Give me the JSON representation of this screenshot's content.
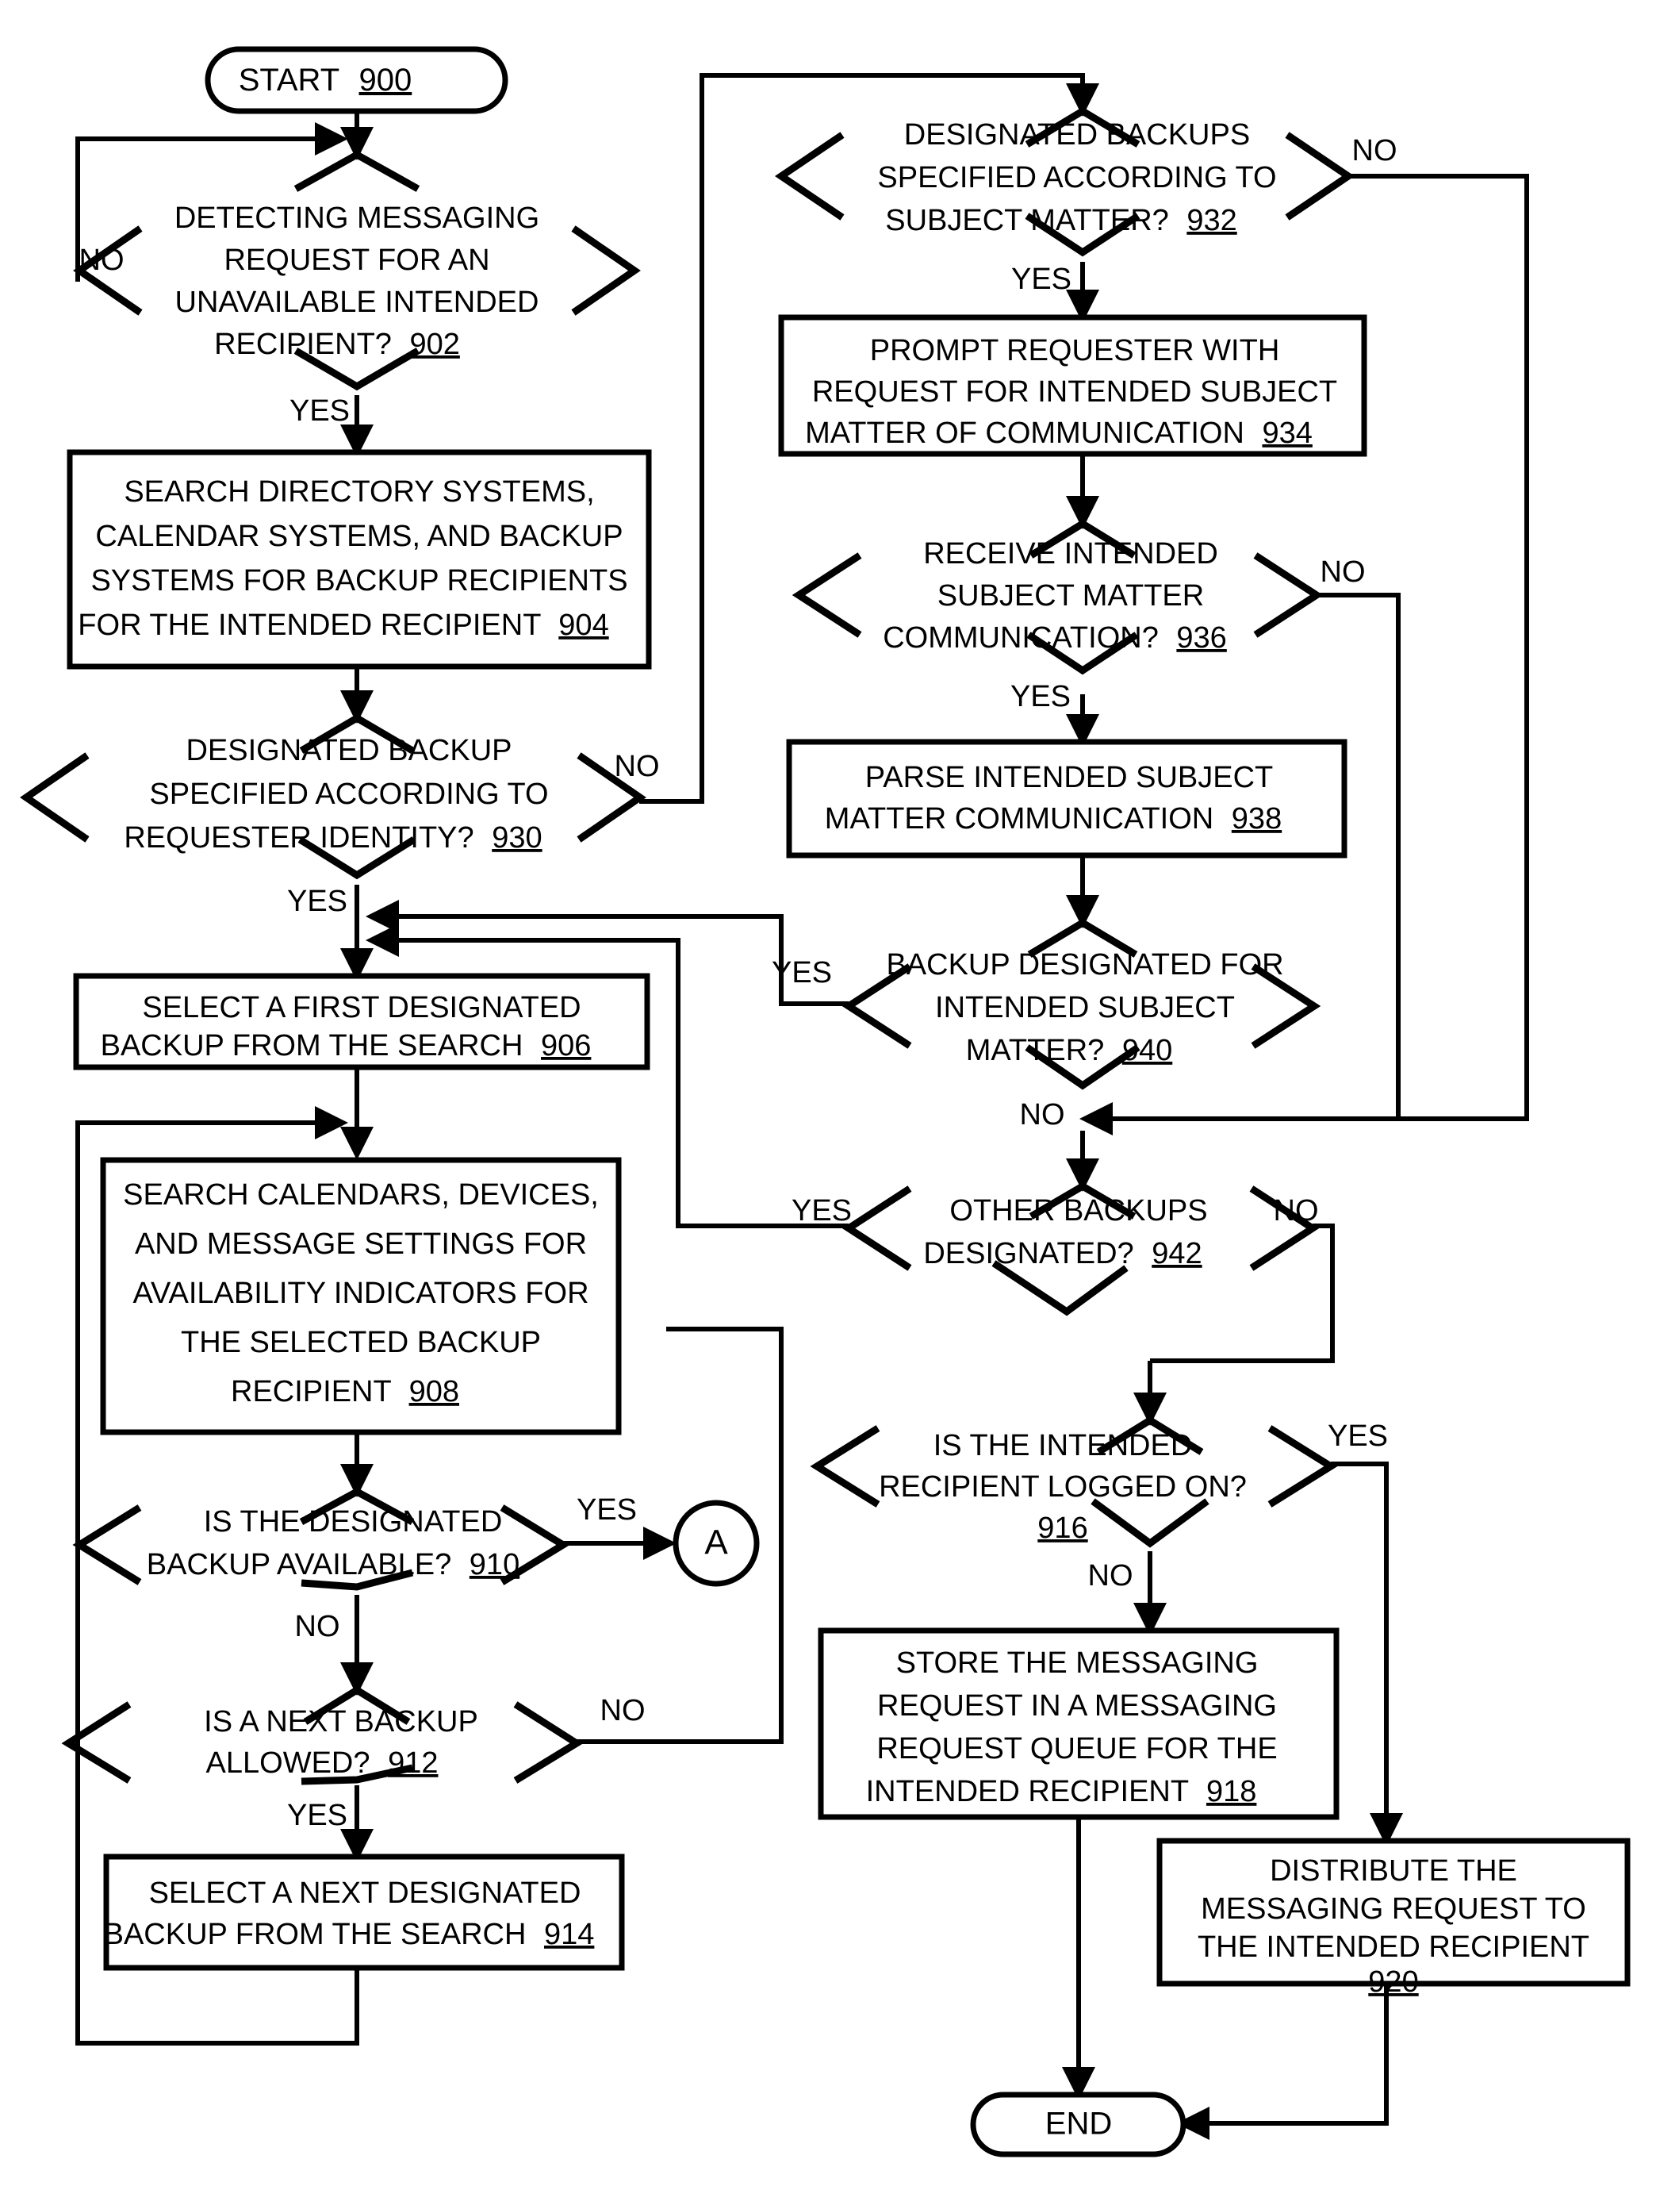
{
  "figure": {
    "type": "patent-flowchart",
    "orientation": "portrait",
    "background_color": "#ffffff",
    "line_color": "#000000"
  },
  "nodes": {
    "start": {
      "shape": "terminator",
      "label": "START",
      "ref": "900"
    },
    "n902": {
      "shape": "decision",
      "lines": [
        "DETECTING MESSAGING",
        "REQUEST FOR AN",
        "UNAVAILABLE INTENDED",
        "RECIPIENT?"
      ],
      "ref": "902"
    },
    "n904": {
      "shape": "process",
      "lines": [
        "SEARCH DIRECTORY SYSTEMS,",
        "CALENDAR SYSTEMS, AND BACKUP",
        "SYSTEMS FOR BACKUP RECIPIENTS",
        "FOR THE INTENDED RECIPIENT"
      ],
      "ref": "904"
    },
    "n930": {
      "shape": "decision",
      "lines": [
        "DESIGNATED BACKUP",
        "SPECIFIED ACCORDING TO",
        "REQUESTER IDENTITY?"
      ],
      "ref": "930"
    },
    "n906": {
      "shape": "process",
      "lines": [
        "SELECT A FIRST DESIGNATED",
        "BACKUP FROM THE SEARCH"
      ],
      "ref": "906"
    },
    "n908": {
      "shape": "process",
      "lines": [
        "SEARCH CALENDARS, DEVICES,",
        "AND MESSAGE SETTINGS FOR",
        "AVAILABILITY INDICATORS FOR",
        "THE SELECTED BACKUP",
        "RECIPIENT"
      ],
      "ref": "908"
    },
    "n910": {
      "shape": "decision",
      "lines": [
        "IS THE DESIGNATED",
        "BACKUP AVAILABLE?"
      ],
      "ref": "910"
    },
    "n912": {
      "shape": "decision",
      "lines": [
        "IS A NEXT BACKUP",
        "ALLOWED?"
      ],
      "ref": "912"
    },
    "n914": {
      "shape": "process",
      "lines": [
        "SELECT A NEXT DESIGNATED",
        "BACKUP FROM THE SEARCH"
      ],
      "ref": "914"
    },
    "connA": {
      "shape": "connector",
      "label": "A"
    },
    "n932": {
      "shape": "decision",
      "lines": [
        "DESIGNATED BACKUPS",
        "SPECIFIED ACCORDING TO",
        "SUBJECT MATTER?"
      ],
      "ref": "932"
    },
    "n934": {
      "shape": "process",
      "lines": [
        "PROMPT REQUESTER WITH",
        "REQUEST FOR INTENDED SUBJECT",
        "MATTER OF COMMUNICATION"
      ],
      "ref": "934"
    },
    "n936": {
      "shape": "decision",
      "lines": [
        "RECEIVE INTENDED",
        "SUBJECT MATTER",
        "COMMUNICATION?"
      ],
      "ref": "936"
    },
    "n938": {
      "shape": "process",
      "lines": [
        "PARSE INTENDED SUBJECT",
        "MATTER COMMUNICATION"
      ],
      "ref": "938"
    },
    "n940": {
      "shape": "decision",
      "lines": [
        "BACKUP DESIGNATED FOR",
        "INTENDED SUBJECT",
        "MATTER?"
      ],
      "ref": "940"
    },
    "n942": {
      "shape": "decision",
      "lines": [
        "OTHER BACKUPS",
        "DESIGNATED?"
      ],
      "ref": "942"
    },
    "n916": {
      "shape": "decision",
      "lines": [
        "IS THE INTENDED",
        "RECIPIENT LOGGED ON?"
      ],
      "ref": "916"
    },
    "n918": {
      "shape": "process",
      "lines": [
        "STORE THE MESSAGING",
        "REQUEST IN A MESSAGING",
        "REQUEST QUEUE FOR THE",
        "INTENDED RECIPIENT"
      ],
      "ref": "918"
    },
    "n920": {
      "shape": "process",
      "lines": [
        "DISTRIBUTE THE",
        "MESSAGING REQUEST TO",
        "THE INTENDED RECIPIENT"
      ],
      "ref": "920"
    },
    "end": {
      "shape": "terminator",
      "label": "END",
      "ref": ""
    }
  },
  "edge_labels": {
    "e902_no": "NO",
    "e902_yes": "YES",
    "e930_no": "NO",
    "e930_yes": "YES",
    "e910_yes": "YES",
    "e910_no": "NO",
    "e912_no": "NO",
    "e912_yes": "YES",
    "e932_no": "NO",
    "e932_yes": "YES",
    "e936_no": "NO",
    "e936_yes": "YES",
    "e940_yes": "YES",
    "e940_no": "NO",
    "e942_yes": "YES",
    "e942_no": "NO",
    "e916_yes": "YES",
    "e916_no": "NO"
  }
}
